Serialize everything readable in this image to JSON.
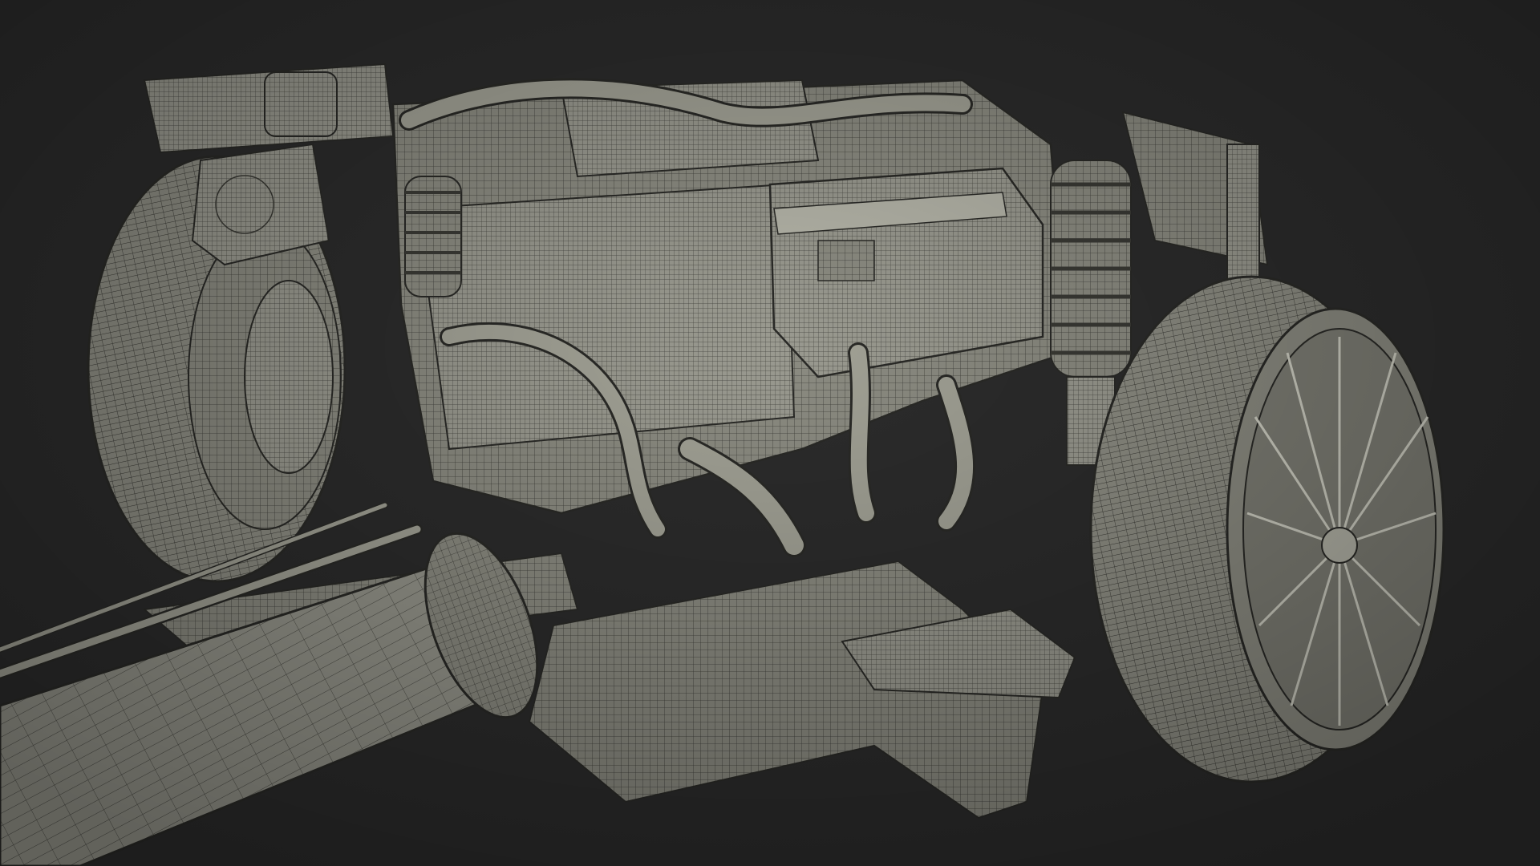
{
  "scene": {
    "background_color": "#2c2c2c",
    "wire_color": "#d8d8c6",
    "surface_color": "#8a8a7f",
    "line_color": "#3a3a36",
    "subject": "wireframe-render-of-vehicle-chassis-and-powertrain"
  }
}
